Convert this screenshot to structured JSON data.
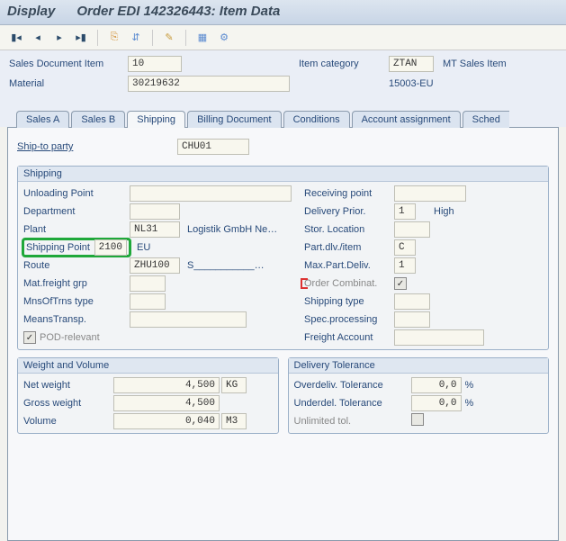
{
  "title": {
    "app": "Display",
    "doc": "Order EDI 142326443: Item Data"
  },
  "header": {
    "sales_doc_item_label": "Sales Document Item",
    "sales_doc_item": "10",
    "material_label": "Material",
    "material": "30219632",
    "item_category_label": "Item category",
    "item_category": "ZTAN",
    "item_category_text": "MT Sales Item",
    "material_text": "15003-EU"
  },
  "tabs": [
    "Sales A",
    "Sales B",
    "Shipping",
    "Billing Document",
    "Conditions",
    "Account assignment",
    "Sched"
  ],
  "active_tab": 2,
  "ship_to": {
    "label": "Ship-to party",
    "value": "CHU01"
  },
  "shipping": {
    "title": "Shipping",
    "rows": {
      "unloading_point": {
        "lbl": "Unloading Point",
        "val": "",
        "rlbl": "Receiving point",
        "rval": ""
      },
      "department": {
        "lbl": "Department",
        "val": "",
        "rlbl": "Delivery Prior.",
        "rval": "1",
        "rtext": "High"
      },
      "plant": {
        "lbl": "Plant",
        "val": "NL31",
        "mid": "Logistik GmbH Ne…",
        "rlbl": "Stor. Location",
        "rval": ""
      },
      "shipping_point": {
        "lbl": "Shipping Point",
        "val": "2100",
        "mid": "EU",
        "rlbl": "Part.dlv./item",
        "rval": "C"
      },
      "route": {
        "lbl": "Route",
        "val": "ZHU100",
        "mid": "S___________…",
        "rlbl": "Max.Part.Deliv.",
        "rval": "1"
      },
      "mat_freight": {
        "lbl": "Mat.freight grp",
        "val": "",
        "rlbl": "Order Combinat.",
        "rchecked": true
      },
      "mnsoftrns": {
        "lbl": "MnsOfTrns type",
        "val": "",
        "rlbl": "Shipping type",
        "rval": ""
      },
      "meanstransp": {
        "lbl": "MeansTransp.",
        "val": "",
        "rlbl": "Spec.processing",
        "rval": ""
      },
      "pod": {
        "lbl": "POD-relevant",
        "checked": true,
        "rlbl": "Freight Account",
        "rval": ""
      }
    }
  },
  "weight_volume": {
    "title": "Weight and Volume",
    "net_weight_lbl": "Net weight",
    "net_weight": "4,500",
    "net_weight_u": "KG",
    "gross_weight_lbl": "Gross weight",
    "gross_weight": "4,500",
    "volume_lbl": "Volume",
    "volume": "0,040",
    "volume_u": "M3"
  },
  "delivery_tol": {
    "title": "Delivery Tolerance",
    "over_lbl": "Overdeliv. Tolerance",
    "over": "0,0",
    "pct": "%",
    "under_lbl": "Underdel. Tolerance",
    "under": "0,0",
    "unlimited_lbl": "Unlimited tol.",
    "unlimited": false
  }
}
